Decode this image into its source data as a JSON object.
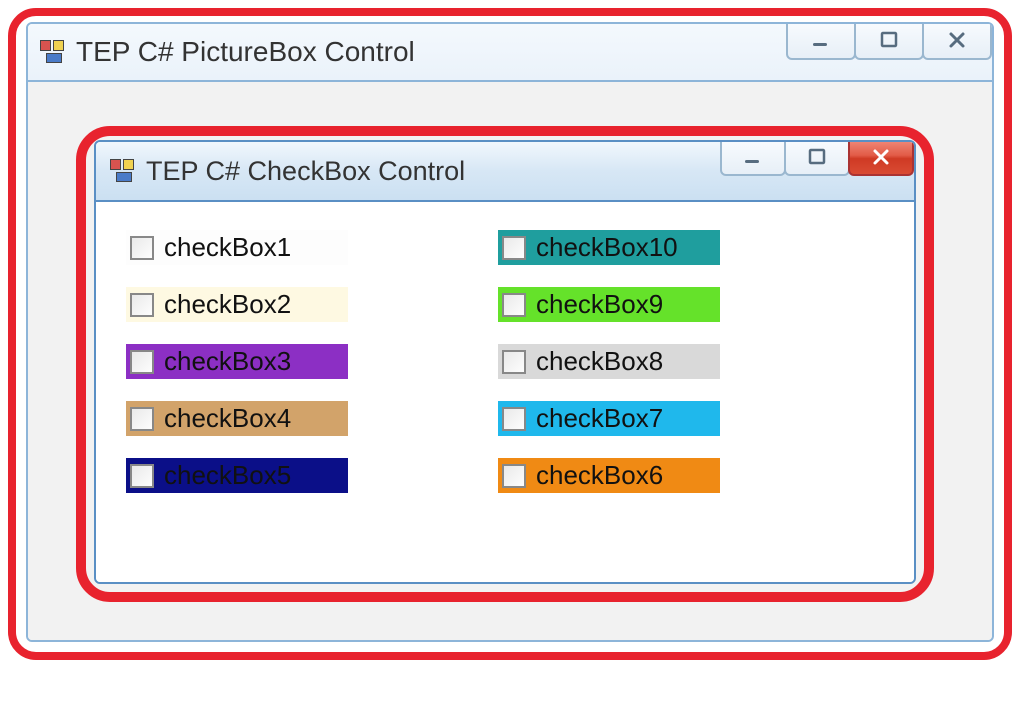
{
  "outer": {
    "title": "TEP C# PictureBox Control"
  },
  "inner": {
    "title": "TEP C# CheckBox Control",
    "left": [
      {
        "label": "checkBox1",
        "bg": "#fdfdfd"
      },
      {
        "label": "checkBox2",
        "bg": "#fef9e2"
      },
      {
        "label": "checkBox3",
        "bg": "#8c2fc4"
      },
      {
        "label": "checkBox4",
        "bg": "#d2a36a"
      },
      {
        "label": "checkBox5",
        "bg": "#0b0f88"
      }
    ],
    "right": [
      {
        "label": "checkBox10",
        "bg": "#1f9e9e"
      },
      {
        "label": "checkBox9",
        "bg": "#65e22a"
      },
      {
        "label": "checkBox8",
        "bg": "#d9d9d9"
      },
      {
        "label": "checkBox7",
        "bg": "#1fb8ec"
      },
      {
        "label": "checkBox6",
        "bg": "#f08a14"
      }
    ]
  }
}
